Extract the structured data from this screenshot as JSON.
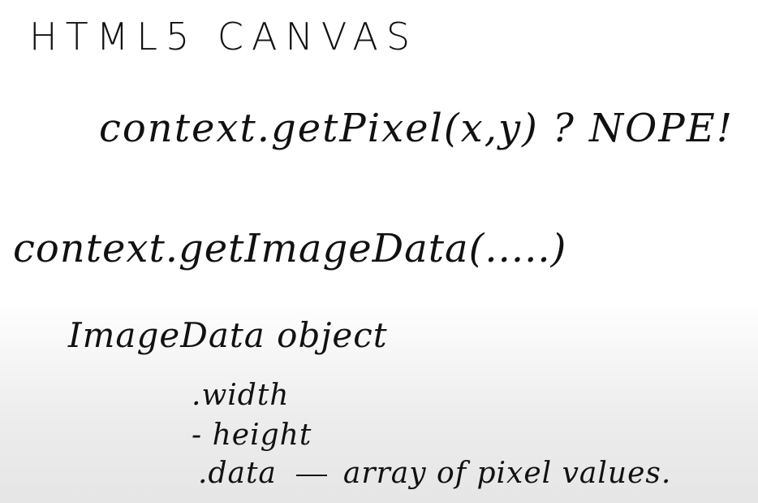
{
  "whiteboard": {
    "title": "HTML5 CANVAS",
    "line1": "context.getPixel(x,y) ? NOPE!",
    "line2": "context.getImageData(.....)",
    "line3": "ImageData object",
    "bullets": [
      {
        "text": ".width"
      },
      {
        "text": "- height"
      },
      {
        "name": ".data",
        "description": "array of pixel values."
      }
    ]
  }
}
